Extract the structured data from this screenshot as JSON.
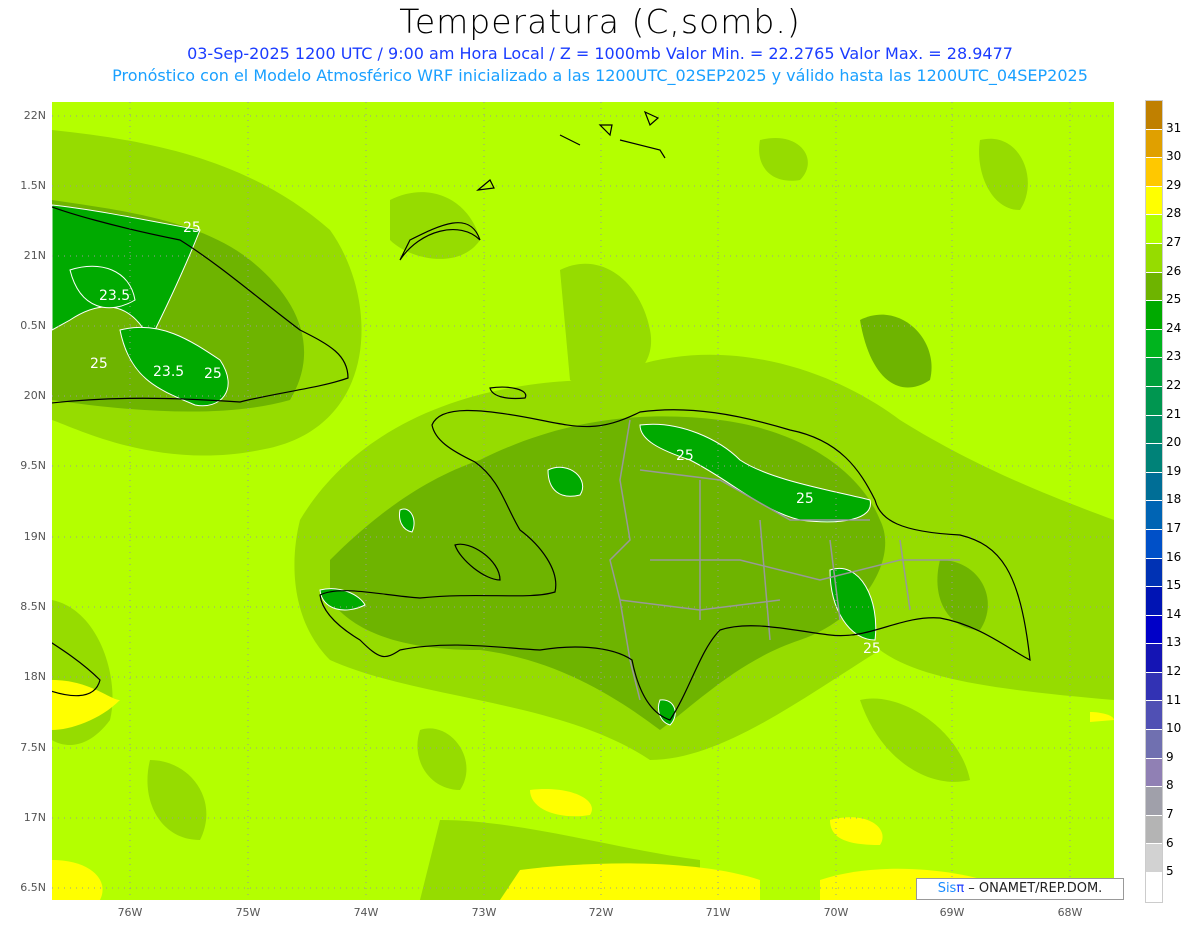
{
  "header": {
    "title": "Temperatura (C,somb.)",
    "subtitle": "03-Sep-2025  1200 UTC / 9:00 am Hora Local / Z = 1000mb   Valor Min. = 22.2765  Valor Max. = 28.9477",
    "model_line": "Pronóstico con el Modelo Atmosférico WRF inicializado a las 1200UTC_02SEP2025 y válido hasta las  1200UTC_04SEP2025"
  },
  "axes": {
    "lat_labels": [
      "22N",
      "1.5N",
      "21N",
      "0.5N",
      "20N",
      "9.5N",
      "19N",
      "8.5N",
      "18N",
      "7.5N",
      "17N",
      "6.5N"
    ],
    "lon_labels": [
      "76W",
      "75W",
      "74W",
      "73W",
      "72W",
      "71W",
      "70W",
      "69W",
      "68W"
    ]
  },
  "contour_labels": [
    "25",
    "23.5",
    "25",
    "23.5",
    "25",
    "25",
    "25",
    "25"
  ],
  "colorbar": {
    "labels": [
      "31",
      "30",
      "29",
      "28",
      "27",
      "26",
      "25",
      "24",
      "23",
      "22",
      "21",
      "20",
      "19",
      "18",
      "17",
      "16",
      "15",
      "14",
      "13",
      "12",
      "11",
      "10",
      "9",
      "8",
      "7",
      "6",
      "5"
    ],
    "colors": [
      "#c08000",
      "#e0a000",
      "#ffc800",
      "#ffff00",
      "#b4ff00",
      "#96dc00",
      "#6eb400",
      "#00aa00",
      "#00b41e",
      "#00a03c",
      "#009650",
      "#008c64",
      "#008278",
      "#006e96",
      "#0064b4",
      "#0050c8",
      "#0032b4",
      "#0014b4",
      "#0000c8",
      "#1414b4",
      "#3232b4",
      "#5050b4",
      "#7070b0",
      "#9080b4",
      "#a0a0aa",
      "#b4b4b4",
      "#d2d2d2",
      "#ffffff"
    ]
  },
  "credit": {
    "sis": "Sis",
    "pi": "π",
    "rest": " – ONAMET/REP.DOM."
  }
}
